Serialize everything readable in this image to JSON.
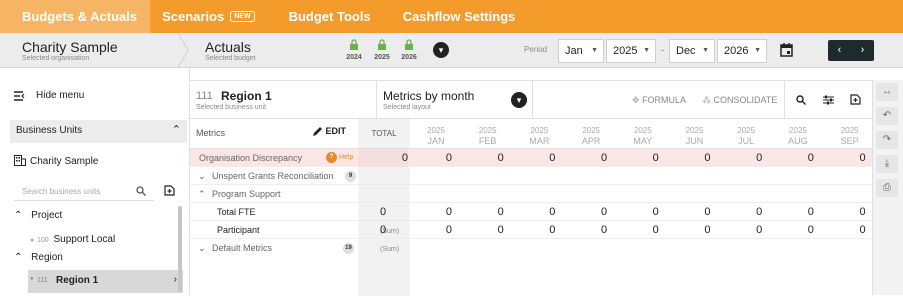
{
  "nav": {
    "tabs": [
      "Budgets & Actuals",
      "Scenarios",
      "Budget Tools",
      "Cashflow Settings"
    ],
    "new_badge": "NEW"
  },
  "subheader": {
    "org_name": "Charity Sample",
    "org_sub": "Selected organisation",
    "budget_name": "Actuals",
    "budget_sub": "Selected budget",
    "locks": [
      "2024",
      "2025",
      "2026"
    ],
    "period_label": "Period",
    "from_month": "Jan",
    "from_year": "2025",
    "dash": "-",
    "to_month": "Dec",
    "to_year": "2026"
  },
  "sidebar": {
    "hide_menu": "Hide menu",
    "section": "Business Units",
    "org": "Charity Sample",
    "search_placeholder": "Search business units",
    "groups": [
      {
        "label": "Project",
        "item_code": "100",
        "item_label": "Support Local"
      },
      {
        "label": "Region",
        "item_code": "111",
        "item_label": "Region 1"
      }
    ]
  },
  "grid": {
    "unit_code": "111",
    "unit_name": "Region 1",
    "unit_sub": "Selected business unit",
    "layout_name": "Metrics by month",
    "layout_sub": "Selected layout",
    "formula": "FORMULA",
    "consolidate": "CONSOLIDATE",
    "metrics_label": "Metrics",
    "edit": "EDIT",
    "total_label": "TOTAL",
    "months": [
      {
        "y": "2025",
        "m": "JAN"
      },
      {
        "y": "2025",
        "m": "FEB"
      },
      {
        "y": "2025",
        "m": "MAR"
      },
      {
        "y": "2025",
        "m": "APR"
      },
      {
        "y": "2025",
        "m": "MAY"
      },
      {
        "y": "2025",
        "m": "JUN"
      },
      {
        "y": "2025",
        "m": "JUL"
      },
      {
        "y": "2025",
        "m": "AUG"
      },
      {
        "y": "2025",
        "m": "SEP"
      }
    ],
    "discrepancy": {
      "label": "Organisation Discrepancy",
      "help": "Help",
      "total": "0",
      "values": [
        "0",
        "0",
        "0",
        "0",
        "0",
        "0",
        "0",
        "0",
        "0"
      ]
    },
    "groups": [
      {
        "label": "Unspent Grants Reconciliation",
        "count": "9"
      },
      {
        "label": "Program Support"
      },
      {
        "label": "Default Metrics",
        "count": "19"
      }
    ],
    "rows": [
      {
        "label": "Total FTE",
        "total": "0",
        "suffix": "(Sum)",
        "values": [
          "0",
          "0",
          "0",
          "0",
          "0",
          "0",
          "0",
          "0",
          "0"
        ]
      },
      {
        "label": "Participant",
        "total": "0",
        "suffix": "(Sum)",
        "values": [
          "0",
          "0",
          "0",
          "0",
          "0",
          "0",
          "0",
          "0",
          "0"
        ]
      }
    ]
  },
  "colors": {
    "accent": "#f39c2c",
    "active_tab": "#f6b564",
    "discrepancy_bg": "#fbe6e6"
  }
}
